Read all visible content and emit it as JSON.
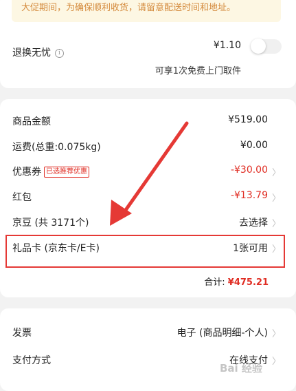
{
  "notice": {
    "text": "大促期间，为确保顺利收货，请留意配送时间和地址。"
  },
  "return_insurance": {
    "label": "退换无忧",
    "price": "¥1.10",
    "desc": "可享1次免费上门取件"
  },
  "order_summary": {
    "goods": {
      "label": "商品金额",
      "value": "¥519.00"
    },
    "shipping": {
      "label": "运费(总重:0.075kg)",
      "value": "¥0.00"
    },
    "coupon": {
      "label": "优惠券",
      "tag": "已选推荐优惠",
      "value": "-¥30.00"
    },
    "redpacket": {
      "label": "红包",
      "value": "-¥13.79"
    },
    "jingdou": {
      "label": "京豆 (共 3171个)",
      "value": "去选择"
    },
    "giftcard": {
      "label": "礼品卡 (京东卡/E卡)",
      "value": "1张可用"
    },
    "total": {
      "label": "合计: ",
      "value": "¥475.21"
    }
  },
  "invoice": {
    "label": "发票",
    "value": "电子 (商品明细-个人)"
  },
  "payment": {
    "label": "支付方式",
    "value": "在线支付"
  },
  "watermark": {
    "text": "Bai 经验"
  },
  "colors": {
    "accent_red": "#e02e24",
    "notice_bg": "#fdf7e3",
    "notice_text": "#d48a3c",
    "annotation_red": "#e53935"
  },
  "icons": [
    "info-icon",
    "chevron-right-icon",
    "toggle-switch"
  ]
}
